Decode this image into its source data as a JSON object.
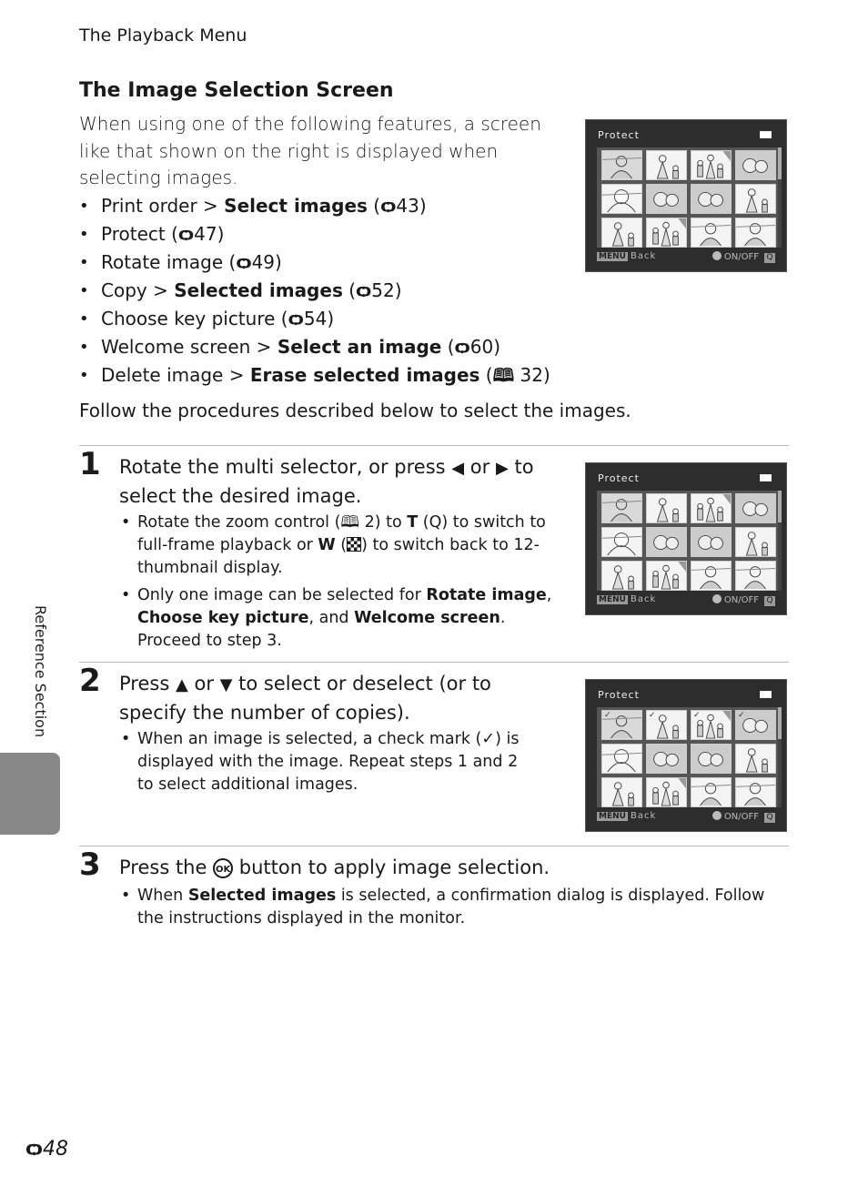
{
  "running_head": "The Playback Menu",
  "section_title": "The Image Selection Screen",
  "intro": "When using one of the following features, a screen like that shown on the right is displayed when selecting images.",
  "features": [
    {
      "plain": "Print order > ",
      "bold": "Select images",
      "ref_icon": "reference-binoculars-icon",
      "ref": "43"
    },
    {
      "plain": "Protect",
      "bold": "",
      "ref_icon": "reference-binoculars-icon",
      "ref": "47"
    },
    {
      "plain": "Rotate image",
      "bold": "",
      "ref_icon": "reference-binoculars-icon",
      "ref": "49"
    },
    {
      "plain": "Copy > ",
      "bold": "Selected images",
      "ref_icon": "reference-binoculars-icon",
      "ref": "52"
    },
    {
      "plain": "Choose key picture",
      "bold": "",
      "ref_icon": "reference-binoculars-icon",
      "ref": "54"
    },
    {
      "plain": "Welcome screen > ",
      "bold": "Select an image",
      "ref_icon": "reference-binoculars-icon",
      "ref": "60"
    },
    {
      "plain": "Delete image > ",
      "bold": "Erase selected images",
      "ref_icon": "book-icon",
      "ref": "32"
    }
  ],
  "follow_text": "Follow the procedures described below to select the images.",
  "icons": {
    "binoculars": "ѻ",
    "book": "🕮",
    "left": "◀",
    "right": "▶",
    "up": "▲",
    "down": "▼",
    "magnify": "Q",
    "check": "✓",
    "ok": "OK"
  },
  "steps": [
    {
      "number": "1",
      "head_a": "Rotate the multi selector, or press ",
      "head_or": " or ",
      "head_b": " to select the desired image.",
      "bullets": [
        {
          "a": "Rotate the zoom control (",
          "b": " 2) to ",
          "t": "T",
          "c": " (",
          "d": ") to switch to full-frame playback or ",
          "w": "W",
          "e": " (",
          "f": ") to switch back to 12-thumbnail display."
        },
        {
          "a": "Only one image can be selected for ",
          "b1": "Rotate image",
          "c": ", ",
          "b2": "Choose key picture",
          "d": ", and ",
          "b3": "Welcome screen",
          "e": ". Proceed to step 3."
        }
      ]
    },
    {
      "number": "2",
      "head_a": "Press ",
      "head_or": " or ",
      "head_b": " to select or deselect (or to specify the number of copies).",
      "bullets": [
        {
          "a": "When an image is selected, a check mark (",
          "b": ") is displayed with the image. Repeat steps 1 and 2 to select additional images."
        }
      ]
    },
    {
      "number": "3",
      "head_a": "Press the ",
      "head_b": " button to apply image selection.",
      "bullets": [
        {
          "a": "When ",
          "bold": "Selected images",
          "b": " is selected, a confirmation dialog is displayed. Follow the instructions displayed in the monitor."
        }
      ]
    }
  ],
  "camera_screens": [
    {
      "title": "Protect",
      "menu_key": "MENU",
      "back": "Back",
      "toggle": "ON/OFF",
      "zoom_key": "Q",
      "checked": [
        false,
        false,
        false,
        false,
        false,
        false,
        false,
        false,
        false,
        false,
        false,
        false
      ]
    },
    {
      "title": "Protect",
      "menu_key": "MENU",
      "back": "Back",
      "toggle": "ON/OFF",
      "zoom_key": "Q",
      "checked": [
        false,
        false,
        false,
        false,
        false,
        false,
        false,
        false,
        false,
        false,
        false,
        false
      ]
    },
    {
      "title": "Protect",
      "menu_key": "MENU",
      "back": "Back",
      "toggle": "ON/OFF",
      "zoom_key": "Q",
      "checked": [
        true,
        true,
        true,
        true,
        false,
        false,
        false,
        false,
        false,
        false,
        false,
        false
      ]
    }
  ],
  "thumbnail_subjects": [
    "woman-sea",
    "woman-child",
    "family",
    "flowers",
    "woman-portrait",
    "flowers",
    "flowers",
    "woman-child",
    "woman-child",
    "family",
    "woman-sea",
    "woman-sea"
  ],
  "side_label": "Reference Section",
  "page_number": {
    "prefix": "ѻ",
    "number": "48"
  }
}
